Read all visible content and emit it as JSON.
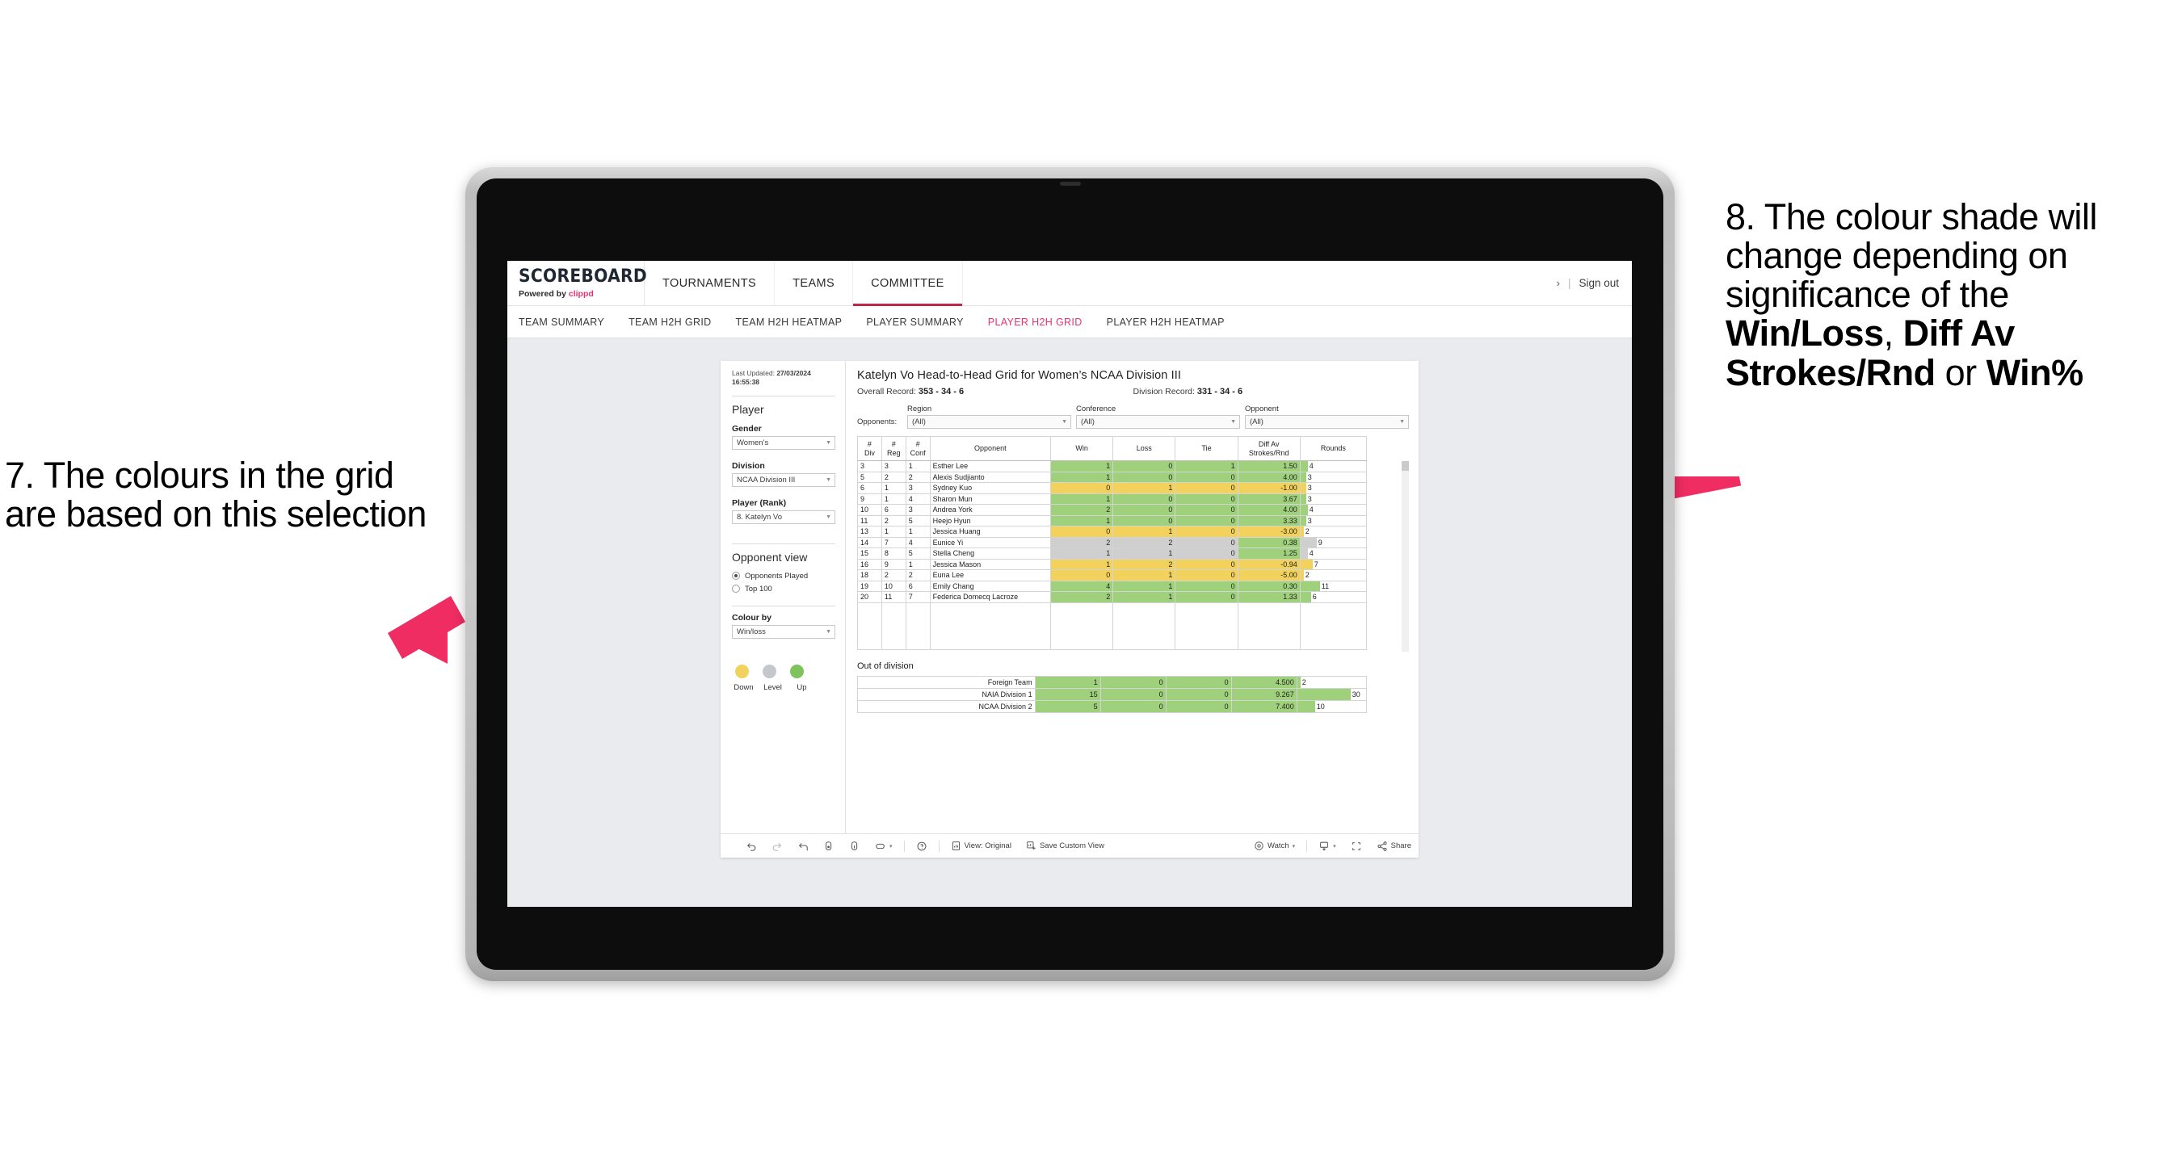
{
  "annotations": {
    "left": {
      "name": "callout-7",
      "text": "7. The colours in the grid are based on this selection"
    },
    "right": {
      "name": "callout-8",
      "prefix": "8. The colour shade will change depending on significance of the ",
      "bold1": "Win/Loss",
      "mid1": ", ",
      "bold2": "Diff Av Strokes/Rnd",
      "mid2": " or ",
      "bold3": "Win%"
    },
    "arrow_color": "#ef2d63"
  },
  "topnav": {
    "brand_title": "SCOREBOARD",
    "brand_sub_prefix": "Powered by ",
    "brand_sub_brand": "clippd",
    "items": [
      {
        "label": "TOURNAMENTS",
        "active": false
      },
      {
        "label": "TEAMS",
        "active": false
      },
      {
        "label": "COMMITTEE",
        "active": true
      }
    ],
    "chevron": "›",
    "separator": "|",
    "signout": "Sign out"
  },
  "subnav": {
    "items": [
      {
        "label": "TEAM SUMMARY",
        "active": false
      },
      {
        "label": "TEAM H2H GRID",
        "active": false
      },
      {
        "label": "TEAM H2H HEATMAP",
        "active": false
      },
      {
        "label": "PLAYER SUMMARY",
        "active": false
      },
      {
        "label": "PLAYER H2H GRID",
        "active": true
      },
      {
        "label": "PLAYER H2H HEATMAP",
        "active": false
      }
    ],
    "active_color": "#e8336d"
  },
  "sidebar": {
    "last_updated_label": "Last Updated:",
    "last_updated_date": "27/03/2024",
    "last_updated_time": "16:55:38",
    "section_player": "Player",
    "gender": {
      "label": "Gender",
      "value": "Women’s"
    },
    "division": {
      "label": "Division",
      "value": "NCAA Division III"
    },
    "player_rank": {
      "label": "Player (Rank)",
      "value": "8. Katelyn Vo"
    },
    "opponent_view": {
      "title": "Opponent view",
      "options": [
        {
          "label": "Opponents Played",
          "selected": true
        },
        {
          "label": "Top 100",
          "selected": false
        }
      ]
    },
    "colour_by": {
      "label": "Colour by",
      "value": "Win/loss"
    },
    "legend": {
      "items": [
        {
          "label": "Down",
          "color": "#f2d25c"
        },
        {
          "label": "Level",
          "color": "#c4c8cc"
        },
        {
          "label": "Up",
          "color": "#7fc35c"
        }
      ]
    }
  },
  "main": {
    "title": "Katelyn Vo Head-to-Head Grid for Women’s NCAA Division III",
    "overall_record_label": "Overall Record:",
    "overall_record_value": "353 - 34 - 6",
    "division_record_label": "Division Record:",
    "division_record_value": "331 - 34 - 6",
    "opponents_label": "Opponents:",
    "filters": [
      {
        "label": "Region",
        "value": "(All)"
      },
      {
        "label": "Conference",
        "value": "(All)"
      },
      {
        "label": "Opponent",
        "value": "(All)"
      }
    ],
    "out_of_division_title": "Out of division"
  },
  "chart_data": {
    "type": "table",
    "title": "Katelyn Vo Head-to-Head Grid for Women’s NCAA Division III",
    "columns": [
      "# Div",
      "# Reg",
      "# Conf",
      "Opponent",
      "Win",
      "Loss",
      "Tie",
      "Diff Av Strokes/Rnd",
      "Rounds"
    ],
    "column_headers_two_line": [
      {
        "l1": "#",
        "l2": "Div"
      },
      {
        "l1": "#",
        "l2": "Reg"
      },
      {
        "l1": "#",
        "l2": "Conf"
      },
      {
        "l1": "Opponent",
        "l2": ""
      },
      {
        "l1": "Win",
        "l2": ""
      },
      {
        "l1": "Loss",
        "l2": ""
      },
      {
        "l1": "Tie",
        "l2": ""
      },
      {
        "l1": "Diff Av",
        "l2": "Strokes/Rnd"
      },
      {
        "l1": "Rounds",
        "l2": ""
      }
    ],
    "rounds_max": 30,
    "rows": [
      {
        "div": "3",
        "reg": "3",
        "conf": "1",
        "opponent": "Esther Lee",
        "win": "1",
        "loss": "0",
        "tie": "1",
        "diff": "1.50",
        "rounds": "4",
        "rounds_val": 4,
        "state": "green"
      },
      {
        "div": "5",
        "reg": "2",
        "conf": "2",
        "opponent": "Alexis Sudjianto",
        "win": "1",
        "loss": "0",
        "tie": "0",
        "diff": "4.00",
        "rounds": "3",
        "rounds_val": 3,
        "state": "green"
      },
      {
        "div": "6",
        "reg": "1",
        "conf": "3",
        "opponent": "Sydney Kuo",
        "win": "0",
        "loss": "1",
        "tie": "0",
        "diff": "-1.00",
        "rounds": "3",
        "rounds_val": 3,
        "state": "yellow"
      },
      {
        "div": "9",
        "reg": "1",
        "conf": "4",
        "opponent": "Sharon Mun",
        "win": "1",
        "loss": "0",
        "tie": "0",
        "diff": "3.67",
        "rounds": "3",
        "rounds_val": 3,
        "state": "green"
      },
      {
        "div": "10",
        "reg": "6",
        "conf": "3",
        "opponent": "Andrea York",
        "win": "2",
        "loss": "0",
        "tie": "0",
        "diff": "4.00",
        "rounds": "4",
        "rounds_val": 4,
        "state": "green"
      },
      {
        "div": "11",
        "reg": "2",
        "conf": "5",
        "opponent": "Heejo Hyun",
        "win": "1",
        "loss": "0",
        "tie": "0",
        "diff": "3.33",
        "rounds": "3",
        "rounds_val": 3,
        "state": "green"
      },
      {
        "div": "13",
        "reg": "1",
        "conf": "1",
        "opponent": "Jessica Huang",
        "win": "0",
        "loss": "1",
        "tie": "0",
        "diff": "-3.00",
        "rounds": "2",
        "rounds_val": 2,
        "state": "yellow"
      },
      {
        "div": "14",
        "reg": "7",
        "conf": "4",
        "opponent": "Eunice Yi",
        "win": "2",
        "loss": "2",
        "tie": "0",
        "diff": "0.38",
        "rounds": "9",
        "rounds_val": 9,
        "state": "grey"
      },
      {
        "div": "15",
        "reg": "8",
        "conf": "5",
        "opponent": "Stella Cheng",
        "win": "1",
        "loss": "1",
        "tie": "0",
        "diff": "1.25",
        "rounds": "4",
        "rounds_val": 4,
        "state": "grey"
      },
      {
        "div": "16",
        "reg": "9",
        "conf": "1",
        "opponent": "Jessica Mason",
        "win": "1",
        "loss": "2",
        "tie": "0",
        "diff": "-0.94",
        "rounds": "7",
        "rounds_val": 7,
        "state": "yellow"
      },
      {
        "div": "18",
        "reg": "2",
        "conf": "2",
        "opponent": "Euna Lee",
        "win": "0",
        "loss": "1",
        "tie": "0",
        "diff": "-5.00",
        "rounds": "2",
        "rounds_val": 2,
        "state": "yellow"
      },
      {
        "div": "19",
        "reg": "10",
        "conf": "6",
        "opponent": "Emily Chang",
        "win": "4",
        "loss": "1",
        "tie": "0",
        "diff": "0.30",
        "rounds": "11",
        "rounds_val": 11,
        "state": "green"
      },
      {
        "div": "20",
        "reg": "11",
        "conf": "7",
        "opponent": "Federica Domecq Lacroze",
        "win": "2",
        "loss": "1",
        "tie": "0",
        "diff": "1.33",
        "rounds": "6",
        "rounds_val": 6,
        "state": "green"
      }
    ],
    "out_of_division": {
      "title": "Out of division",
      "rounds_max": 30,
      "rows": [
        {
          "name": "Foreign Team",
          "win": "1",
          "loss": "0",
          "tie": "0",
          "diff": "4.500",
          "rounds": "2",
          "rounds_val": 2
        },
        {
          "name": "NAIA Division 1",
          "win": "15",
          "loss": "0",
          "tie": "0",
          "diff": "9.267",
          "rounds": "30",
          "rounds_val": 30
        },
        {
          "name": "NCAA Division 2",
          "win": "5",
          "loss": "0",
          "tie": "0",
          "diff": "7.400",
          "rounds": "10",
          "rounds_val": 10
        }
      ]
    },
    "colors": {
      "win": "#9fd17c",
      "loss": "#f2d25c",
      "level": "#cfcfcf"
    }
  },
  "toolbar": {
    "items": [
      {
        "name": "undo-icon",
        "label": ""
      },
      {
        "name": "redo-icon",
        "label": ""
      },
      {
        "name": "revert-icon",
        "label": ""
      },
      {
        "name": "refresh-icon",
        "label": ""
      },
      {
        "name": "pause-icon",
        "label": ""
      },
      {
        "name": "alerts-icon",
        "label": ""
      },
      {
        "name": "help-icon",
        "label": ""
      }
    ],
    "view_original": "View: Original",
    "save_custom_view": "Save Custom View",
    "watch": "Watch",
    "share": "Share",
    "caret": "▾"
  }
}
